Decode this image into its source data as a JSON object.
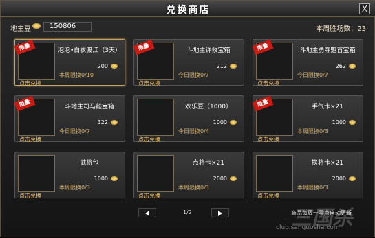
{
  "window": {
    "title": "兑换商店",
    "close_label": "X"
  },
  "topbar": {
    "bean_label": "地主豆",
    "bean_value": "150806",
    "wins_label": "本周胜场数：23"
  },
  "items": [
    {
      "tag": "限量",
      "name": "泡泡•白衣渡江（3天）",
      "qty": "200",
      "limit": "本周限换0/10",
      "redeem": "点击兑换"
    },
    {
      "tag": "限量",
      "name": "斗地主许攸宝箱",
      "qty": "212",
      "limit": "今日限换0/7",
      "redeem": "点击兑换"
    },
    {
      "tag": "限量",
      "name": "斗地主勇夺魁首宝箱",
      "qty": "262",
      "limit": "今日限换0/7",
      "redeem": "点击兑换"
    },
    {
      "tag": "限量",
      "name": "斗地主司马懿宝箱",
      "qty": "322",
      "limit": "今日限换0/7",
      "redeem": "点击兑换"
    },
    {
      "tag": "",
      "name": "欢乐豆（1000）",
      "qty": "1000",
      "limit": "今日限换0/4",
      "redeem": "点击兑换"
    },
    {
      "tag": "限量",
      "name": "手气卡×21",
      "qty": "1000",
      "limit": "本周限换0/3",
      "redeem": "点击兑换"
    },
    {
      "tag": "",
      "name": "武将包",
      "qty": "1000",
      "limit": "本周限换0/3",
      "redeem": "点击兑换"
    },
    {
      "tag": "",
      "name": "点将卡×21",
      "qty": "2000",
      "limit": "本周限换0/3",
      "redeem": "点击兑换"
    },
    {
      "tag": "",
      "name": "换将卡×21",
      "qty": "2000",
      "limit": "本周限换0/3",
      "redeem": "点击兑换"
    }
  ],
  "pager": {
    "page_info": "1/2"
  },
  "footer": {
    "note": "商品每周一零点自动更新",
    "watermark": "三国杀",
    "watermark_url": "club.sanguosha.com"
  }
}
